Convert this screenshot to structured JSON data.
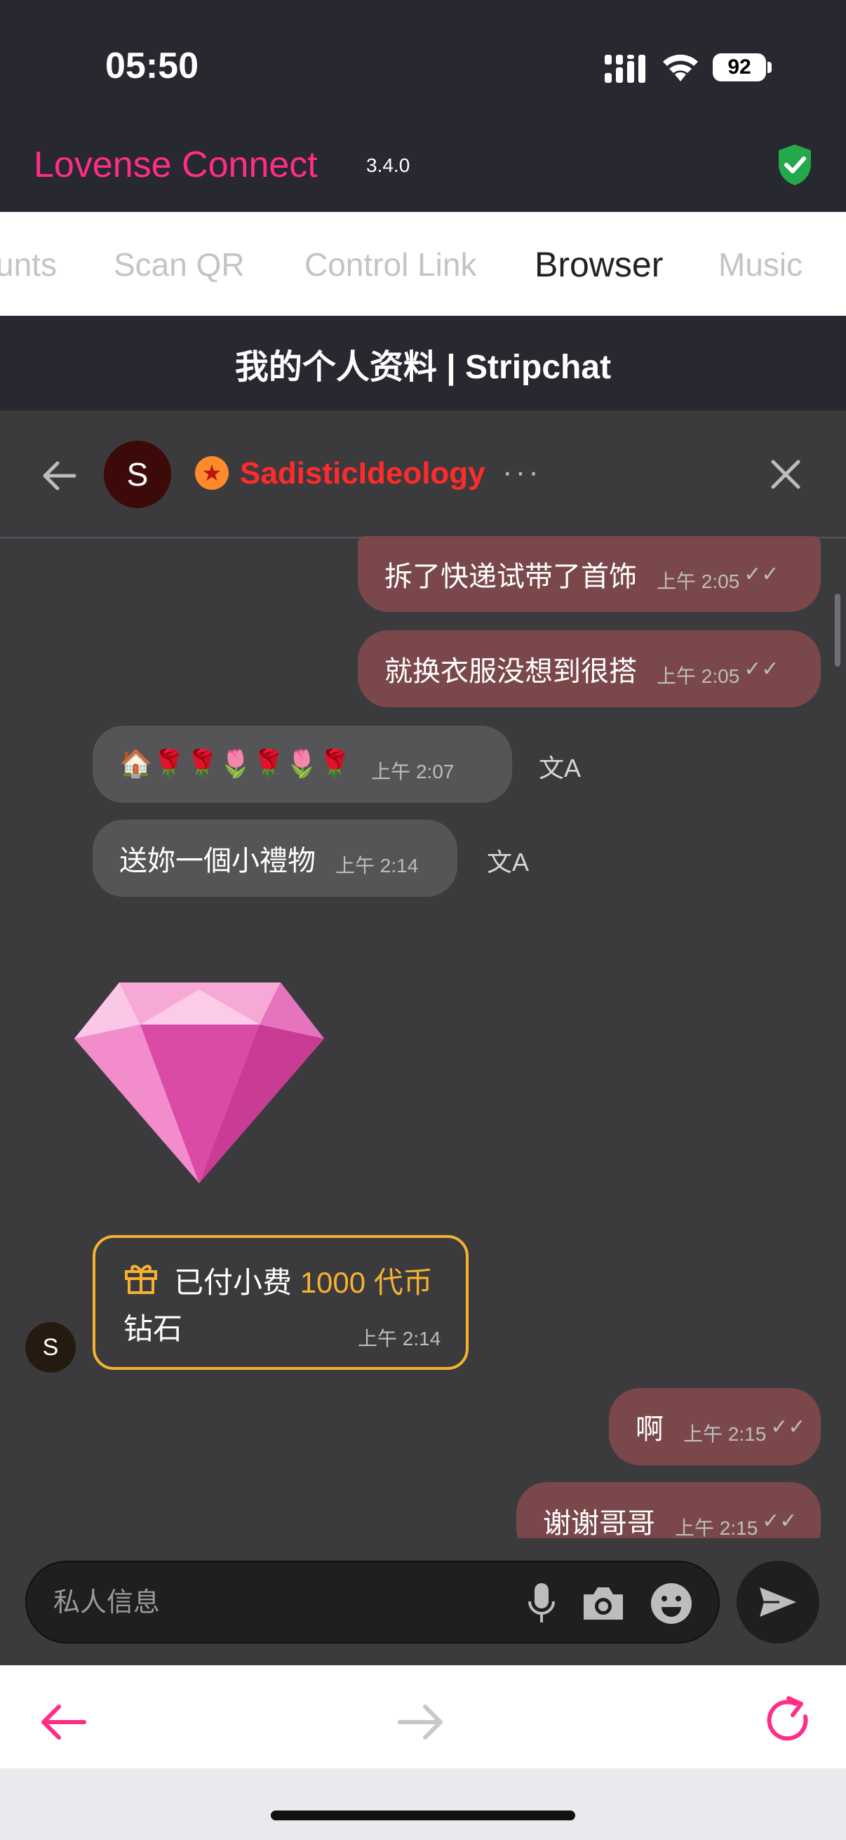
{
  "status_bar": {
    "time": "05:50",
    "battery": "92"
  },
  "app": {
    "title": "Lovense Connect",
    "version": "3.4.0"
  },
  "tabs": [
    {
      "label": "unts"
    },
    {
      "label": "Scan QR"
    },
    {
      "label": "Control Link"
    },
    {
      "label": "Browser"
    },
    {
      "label": "Music"
    }
  ],
  "page_title": "我的个人资料 | Stripchat",
  "chat_header": {
    "avatar_letter": "S",
    "username": "SadisticIdeology",
    "more": "···"
  },
  "messages": [
    {
      "text": "拆了快递试带了首饰",
      "time": "上午 2:05"
    },
    {
      "text": "就换衣服没想到很搭",
      "time": "上午 2:05"
    },
    {
      "text": "🏠🌹🌹🌷🌹🌷🌹",
      "time": "上午 2:07"
    },
    {
      "text": "送妳一個小禮物",
      "time": "上午 2:14"
    },
    {
      "text": "啊",
      "time": "上午 2:15"
    },
    {
      "text": "谢谢哥哥",
      "time": "上午 2:15"
    }
  ],
  "tip": {
    "prefix": "已付小费",
    "amount": "1000 代币",
    "item": "钻石",
    "time": "上午 2:14",
    "avatar_letter": "S"
  },
  "composer": {
    "placeholder": "私人信息"
  },
  "colors": {
    "accent": "#ff2d87",
    "username": "#ff2b2b",
    "tip_border": "#f5b230",
    "outgoing_bubble": "#7a484a",
    "incoming_bubble": "#555557"
  }
}
